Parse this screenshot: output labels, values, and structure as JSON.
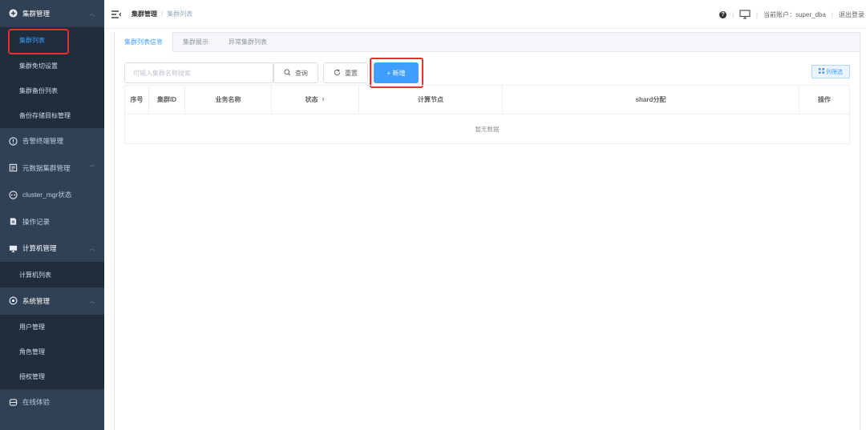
{
  "sidebar": {
    "groups": [
      {
        "label": "集群管理",
        "icon": "plus-circle-icon",
        "open": true,
        "children": [
          "集群列表",
          "集群免切设置",
          "集群备份列表",
          "备份存储目标管理"
        ]
      },
      {
        "label": "告警终端管理",
        "icon": "alert-circle-icon"
      },
      {
        "label": "元数据集群管理",
        "icon": "database-icon"
      },
      {
        "label": "cluster_mgr状态",
        "icon": "cluster-icon"
      },
      {
        "label": "操作记录",
        "icon": "record-icon"
      },
      {
        "label": "计算机管理",
        "icon": "monitor-icon",
        "children": [
          "计算机列表"
        ]
      },
      {
        "label": "系统管理",
        "icon": "settings-icon",
        "children": [
          "用户管理",
          "角色管理",
          "授权管理"
        ]
      },
      {
        "label": "在线体验",
        "icon": "experience-icon"
      }
    ],
    "active_item": "集群列表"
  },
  "header": {
    "breadcrumb": [
      "集群管理",
      "集群列表"
    ],
    "account_label": "当前账户：super_dba",
    "logout_label": "退出登录"
  },
  "main": {
    "tabs": [
      {
        "label": "集群列表信息",
        "active": true
      },
      {
        "label": "集群展示",
        "active": false
      },
      {
        "label": "异常集群列表",
        "active": false
      }
    ],
    "search": {
      "placeholder": "可输入集群名称搜索",
      "value": ""
    },
    "buttons": {
      "search": "查询",
      "reset": "重置",
      "add": "+ 新增",
      "columns": "列筛选"
    },
    "table": {
      "columns": [
        "序号",
        "集群ID",
        "业务名称",
        "状态",
        "计算节点",
        "shard分配",
        "操作"
      ],
      "empty_text": "暂无数据"
    }
  },
  "colors": {
    "sidebar_bg": "#304156",
    "submenu_bg": "#1f2d3d",
    "accent": "#409eff",
    "highlight": "#e5322d"
  }
}
